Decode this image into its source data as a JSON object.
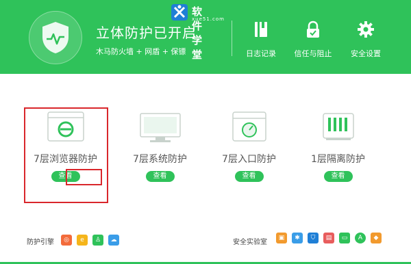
{
  "header": {
    "title": "立体防护已开启",
    "subtitle": "木马防火墙 + 网盾 + 保镖",
    "buttons": [
      {
        "label": "日志记录",
        "icon": "log-book-icon"
      },
      {
        "label": "信任与阻止",
        "icon": "lock-icon"
      },
      {
        "label": "安全设置",
        "icon": "gear-icon"
      }
    ],
    "accent": "#2fc25a"
  },
  "watermark_logo": {
    "text": "软件学堂",
    "url": "xue51.com"
  },
  "features": [
    {
      "name": "7层浏览器防护",
      "button": "查看",
      "icon": "browser-window-icon"
    },
    {
      "name": "7层系统防护",
      "button": "查看",
      "icon": "monitor-icon"
    },
    {
      "name": "7层入口防护",
      "button": "查看",
      "icon": "entry-gauge-icon"
    },
    {
      "name": "1层隔离防护",
      "button": "查看",
      "icon": "isolation-box-icon"
    }
  ],
  "footer": {
    "engine_label": "防护引擎",
    "lab_label": "安全实验室"
  },
  "highlight_color": "#d9262b"
}
